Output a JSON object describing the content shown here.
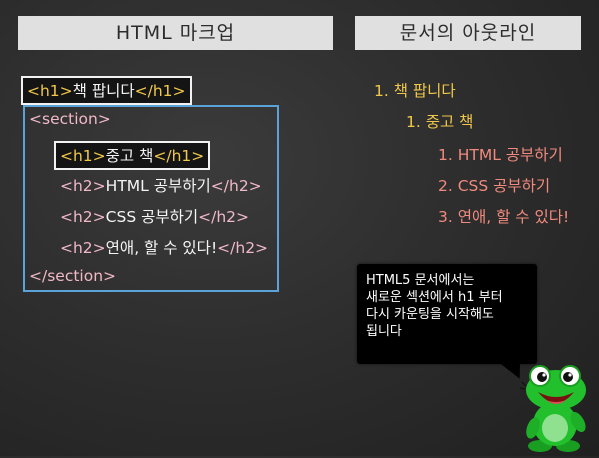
{
  "left_panel": {
    "title": "HTML 마크업",
    "h1_line": {
      "open": "<h1>",
      "text": "책 팝니다",
      "close": "</h1>"
    },
    "section_open": "<section>",
    "inner_h1": {
      "open": "<h1>",
      "text": "중고 책",
      "close": "</h1>"
    },
    "h2_lines": [
      {
        "open": "<h2>",
        "text": "HTML 공부하기",
        "close": "</h2>"
      },
      {
        "open": "<h2>",
        "text": "CSS 공부하기",
        "close": "</h2>"
      },
      {
        "open": "<h2>",
        "text": "연애, 할 수 있다!",
        "close": "</h2>"
      }
    ],
    "section_close": "</section>"
  },
  "right_panel": {
    "title": "문서의 아웃라인",
    "outline": [
      "1. 책 팝니다",
      "1. 중고 책",
      "1. HTML 공부하기",
      "2. CSS 공부하기",
      "3. 연애, 할 수 있다!"
    ]
  },
  "callout": {
    "lines": [
      "HTML5 문서에서는",
      "새로운 섹션에서 h1 부터",
      "다시 카운팅을 시작해도",
      "됩니다"
    ]
  },
  "colors": {
    "tag_yellow": "#f0c84a",
    "tag_pink": "#f0b8c8",
    "section_border": "#5aa3d8",
    "outline_salmon": "#f08a7e",
    "frog_green": "#22c02c"
  },
  "icons": {
    "mascot": "frog-mascot-icon"
  }
}
